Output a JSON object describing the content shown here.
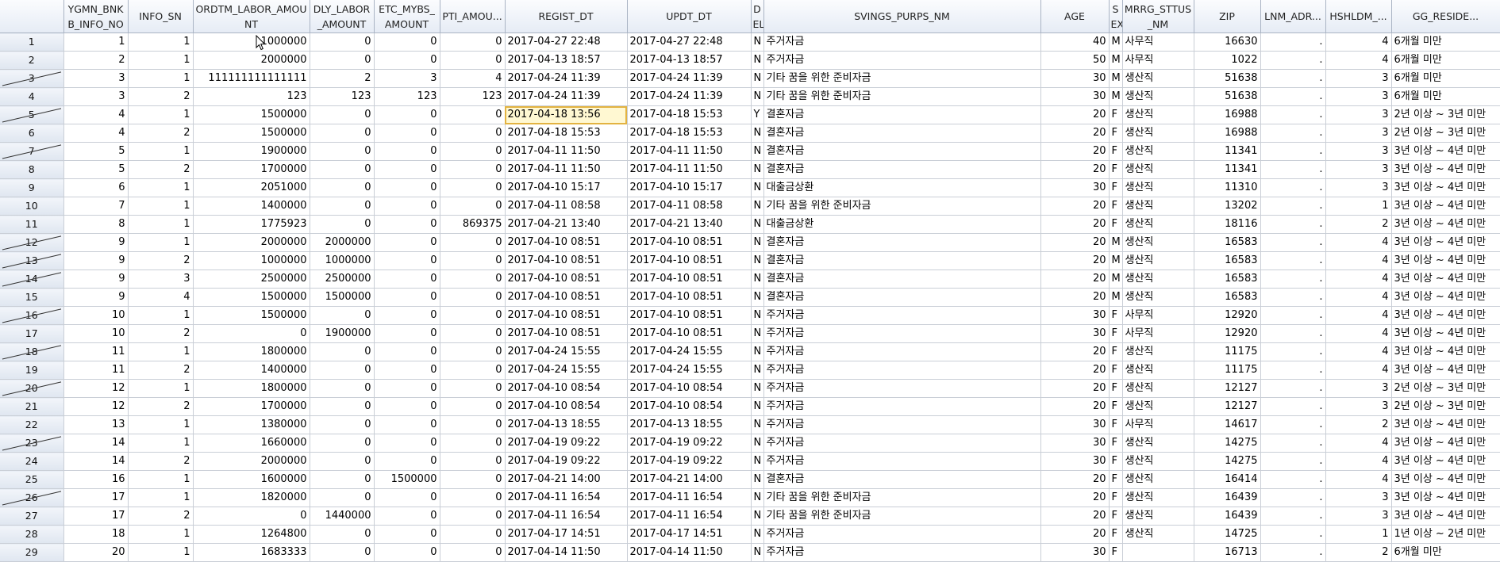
{
  "columns": [
    "",
    "YGMN_BNKB_INFO_NO",
    "INFO_SN",
    "ORDTM_LABOR_AMOUNT",
    "DLY_LABOR_AMOUNT",
    "ETC_MYBS_AMOUNT",
    "PTI_AMOU...",
    "REGIST_DT",
    "UPDT_DT",
    "DEL",
    "SVINGS_PURPS_NM",
    "AGE",
    "SEX",
    "MRRG_STTUS_NM",
    "ZIP",
    "LNM_ADR...",
    "HSHLDM_...",
    "GG_RESIDE..."
  ],
  "header_lines": [
    [
      ""
    ],
    [
      "YGMN_BNK",
      "B_INFO_NO"
    ],
    [
      "INFO_SN"
    ],
    [
      "ORDTM_LABOR_AMOU",
      "NT"
    ],
    [
      "DLY_LABOR",
      "_AMOUNT"
    ],
    [
      "ETC_MYBS_",
      "AMOUNT"
    ],
    [
      "PTI_AMOU..."
    ],
    [
      "REGIST_DT"
    ],
    [
      "UPDT_DT"
    ],
    [
      "D",
      "EL"
    ],
    [
      "SVINGS_PURPS_NM"
    ],
    [
      "AGE"
    ],
    [
      "S",
      "EX"
    ],
    [
      "MRRG_STTUS",
      "_NM"
    ],
    [
      "ZIP"
    ],
    [
      "LNM_ADR..."
    ],
    [
      "HSHLDM_..."
    ],
    [
      "GG_RESIDE..."
    ]
  ],
  "selected_cell": {
    "row": 5,
    "column": "REGIST_DT"
  },
  "accent_color": "#e3b341",
  "rows": [
    {
      "n": "1",
      "struck": false,
      "c": [
        "1",
        "1",
        "1000000",
        "0",
        "0",
        "0",
        "2017-04-27 22:48",
        "2017-04-27 22:48",
        "N",
        "주거자금",
        "40",
        "M",
        "사무직",
        "16630",
        ".",
        "4",
        "6개월 미만"
      ]
    },
    {
      "n": "2",
      "struck": false,
      "c": [
        "2",
        "1",
        "2000000",
        "0",
        "0",
        "0",
        "2017-04-13 18:57",
        "2017-04-13 18:57",
        "N",
        "주거자금",
        "50",
        "M",
        "사무직",
        "1022",
        ".",
        "4",
        "6개월 미만"
      ]
    },
    {
      "n": "3",
      "struck": true,
      "c": [
        "3",
        "1",
        "111111111111111",
        "2",
        "3",
        "4",
        "2017-04-24 11:39",
        "2017-04-24 11:39",
        "N",
        "기타 꿈을 위한 준비자금",
        "30",
        "M",
        "생산직",
        "51638",
        ".",
        "3",
        "6개월 미만"
      ]
    },
    {
      "n": "4",
      "struck": false,
      "c": [
        "3",
        "2",
        "123",
        "123",
        "123",
        "123",
        "2017-04-24 11:39",
        "2017-04-24 11:39",
        "N",
        "기타 꿈을 위한 준비자금",
        "30",
        "M",
        "생산직",
        "51638",
        ".",
        "3",
        "6개월 미만"
      ]
    },
    {
      "n": "5",
      "struck": true,
      "c": [
        "4",
        "1",
        "1500000",
        "0",
        "0",
        "0",
        "2017-04-18 13:56",
        "2017-04-18 15:53",
        "Y",
        "결혼자금",
        "20",
        "F",
        "생산직",
        "16988",
        ".",
        "3",
        "2년 이상 ~ 3년 미만"
      ]
    },
    {
      "n": "6",
      "struck": false,
      "c": [
        "4",
        "2",
        "1500000",
        "0",
        "0",
        "0",
        "2017-04-18 15:53",
        "2017-04-18 15:53",
        "N",
        "결혼자금",
        "20",
        "F",
        "생산직",
        "16988",
        ".",
        "3",
        "2년 이상 ~ 3년 미만"
      ]
    },
    {
      "n": "7",
      "struck": true,
      "c": [
        "5",
        "1",
        "1900000",
        "0",
        "0",
        "0",
        "2017-04-11 11:50",
        "2017-04-11 11:50",
        "N",
        "결혼자금",
        "20",
        "F",
        "생산직",
        "11341",
        ".",
        "3",
        "3년 이상 ~ 4년 미만"
      ]
    },
    {
      "n": "8",
      "struck": false,
      "c": [
        "5",
        "2",
        "1700000",
        "0",
        "0",
        "0",
        "2017-04-11 11:50",
        "2017-04-11 11:50",
        "N",
        "결혼자금",
        "20",
        "F",
        "생산직",
        "11341",
        ".",
        "3",
        "3년 이상 ~ 4년 미만"
      ]
    },
    {
      "n": "9",
      "struck": false,
      "c": [
        "6",
        "1",
        "2051000",
        "0",
        "0",
        "0",
        "2017-04-10 15:17",
        "2017-04-10 15:17",
        "N",
        "대출금상환",
        "30",
        "F",
        "생산직",
        "11310",
        ".",
        "3",
        "3년 이상 ~ 4년 미만"
      ]
    },
    {
      "n": "10",
      "struck": false,
      "c": [
        "7",
        "1",
        "1400000",
        "0",
        "0",
        "0",
        "2017-04-11 08:58",
        "2017-04-11 08:58",
        "N",
        "기타 꿈을 위한 준비자금",
        "20",
        "F",
        "생산직",
        "13202",
        ".",
        "1",
        "3년 이상 ~ 4년 미만"
      ]
    },
    {
      "n": "11",
      "struck": false,
      "c": [
        "8",
        "1",
        "1775923",
        "0",
        "0",
        "869375",
        "2017-04-21 13:40",
        "2017-04-21 13:40",
        "N",
        "대출금상환",
        "20",
        "F",
        "생산직",
        "18116",
        ".",
        "2",
        "3년 이상 ~ 4년 미만"
      ]
    },
    {
      "n": "12",
      "struck": true,
      "c": [
        "9",
        "1",
        "2000000",
        "2000000",
        "0",
        "0",
        "2017-04-10 08:51",
        "2017-04-10 08:51",
        "N",
        "결혼자금",
        "20",
        "M",
        "생산직",
        "16583",
        ".",
        "4",
        "3년 이상 ~ 4년 미만"
      ]
    },
    {
      "n": "13",
      "struck": true,
      "c": [
        "9",
        "2",
        "1000000",
        "1000000",
        "0",
        "0",
        "2017-04-10 08:51",
        "2017-04-10 08:51",
        "N",
        "결혼자금",
        "20",
        "M",
        "생산직",
        "16583",
        ".",
        "4",
        "3년 이상 ~ 4년 미만"
      ]
    },
    {
      "n": "14",
      "struck": true,
      "c": [
        "9",
        "3",
        "2500000",
        "2500000",
        "0",
        "0",
        "2017-04-10 08:51",
        "2017-04-10 08:51",
        "N",
        "결혼자금",
        "20",
        "M",
        "생산직",
        "16583",
        ".",
        "4",
        "3년 이상 ~ 4년 미만"
      ]
    },
    {
      "n": "15",
      "struck": false,
      "c": [
        "9",
        "4",
        "1500000",
        "1500000",
        "0",
        "0",
        "2017-04-10 08:51",
        "2017-04-10 08:51",
        "N",
        "결혼자금",
        "20",
        "M",
        "생산직",
        "16583",
        ".",
        "4",
        "3년 이상 ~ 4년 미만"
      ]
    },
    {
      "n": "16",
      "struck": true,
      "c": [
        "10",
        "1",
        "1500000",
        "0",
        "0",
        "0",
        "2017-04-10 08:51",
        "2017-04-10 08:51",
        "N",
        "주거자금",
        "30",
        "F",
        "사무직",
        "12920",
        ".",
        "4",
        "3년 이상 ~ 4년 미만"
      ]
    },
    {
      "n": "17",
      "struck": false,
      "c": [
        "10",
        "2",
        "0",
        "1900000",
        "0",
        "0",
        "2017-04-10 08:51",
        "2017-04-10 08:51",
        "N",
        "주거자금",
        "30",
        "F",
        "사무직",
        "12920",
        ".",
        "4",
        "3년 이상 ~ 4년 미만"
      ]
    },
    {
      "n": "18",
      "struck": true,
      "c": [
        "11",
        "1",
        "1800000",
        "0",
        "0",
        "0",
        "2017-04-24 15:55",
        "2017-04-24 15:55",
        "N",
        "주거자금",
        "20",
        "F",
        "생산직",
        "11175",
        ".",
        "4",
        "3년 이상 ~ 4년 미만"
      ]
    },
    {
      "n": "19",
      "struck": false,
      "c": [
        "11",
        "2",
        "1400000",
        "0",
        "0",
        "0",
        "2017-04-24 15:55",
        "2017-04-24 15:55",
        "N",
        "주거자금",
        "20",
        "F",
        "생산직",
        "11175",
        ".",
        "4",
        "3년 이상 ~ 4년 미만"
      ]
    },
    {
      "n": "20",
      "struck": true,
      "c": [
        "12",
        "1",
        "1800000",
        "0",
        "0",
        "0",
        "2017-04-10 08:54",
        "2017-04-10 08:54",
        "N",
        "주거자금",
        "20",
        "F",
        "생산직",
        "12127",
        ".",
        "3",
        "2년 이상 ~ 3년 미만"
      ]
    },
    {
      "n": "21",
      "struck": false,
      "c": [
        "12",
        "2",
        "1700000",
        "0",
        "0",
        "0",
        "2017-04-10 08:54",
        "2017-04-10 08:54",
        "N",
        "주거자금",
        "20",
        "F",
        "생산직",
        "12127",
        ".",
        "3",
        "2년 이상 ~ 3년 미만"
      ]
    },
    {
      "n": "22",
      "struck": false,
      "c": [
        "13",
        "1",
        "1380000",
        "0",
        "0",
        "0",
        "2017-04-13 18:55",
        "2017-04-13 18:55",
        "N",
        "주거자금",
        "30",
        "F",
        "사무직",
        "14617",
        ".",
        "2",
        "3년 이상 ~ 4년 미만"
      ]
    },
    {
      "n": "23",
      "struck": true,
      "c": [
        "14",
        "1",
        "1660000",
        "0",
        "0",
        "0",
        "2017-04-19 09:22",
        "2017-04-19 09:22",
        "N",
        "주거자금",
        "30",
        "F",
        "생산직",
        "14275",
        ".",
        "4",
        "3년 이상 ~ 4년 미만"
      ]
    },
    {
      "n": "24",
      "struck": false,
      "c": [
        "14",
        "2",
        "2000000",
        "0",
        "0",
        "0",
        "2017-04-19 09:22",
        "2017-04-19 09:22",
        "N",
        "주거자금",
        "30",
        "F",
        "생산직",
        "14275",
        ".",
        "4",
        "3년 이상 ~ 4년 미만"
      ]
    },
    {
      "n": "25",
      "struck": false,
      "c": [
        "16",
        "1",
        "1600000",
        "0",
        "1500000",
        "0",
        "2017-04-21 14:00",
        "2017-04-21 14:00",
        "N",
        "결혼자금",
        "20",
        "F",
        "생산직",
        "16414",
        ".",
        "4",
        "3년 이상 ~ 4년 미만"
      ]
    },
    {
      "n": "26",
      "struck": true,
      "c": [
        "17",
        "1",
        "1820000",
        "0",
        "0",
        "0",
        "2017-04-11 16:54",
        "2017-04-11 16:54",
        "N",
        "기타 꿈을 위한 준비자금",
        "20",
        "F",
        "생산직",
        "16439",
        ".",
        "3",
        "3년 이상 ~ 4년 미만"
      ]
    },
    {
      "n": "27",
      "struck": false,
      "c": [
        "17",
        "2",
        "0",
        "1440000",
        "0",
        "0",
        "2017-04-11 16:54",
        "2017-04-11 16:54",
        "N",
        "기타 꿈을 위한 준비자금",
        "20",
        "F",
        "생산직",
        "16439",
        ".",
        "3",
        "3년 이상 ~ 4년 미만"
      ]
    },
    {
      "n": "28",
      "struck": false,
      "c": [
        "18",
        "1",
        "1264800",
        "0",
        "0",
        "0",
        "2017-04-17 14:51",
        "2017-04-17 14:51",
        "N",
        "주거자금",
        "20",
        "F",
        "생산직",
        "14725",
        ".",
        "1",
        "1년 이상 ~ 2년 미만"
      ]
    },
    {
      "n": "29",
      "struck": false,
      "c": [
        "20",
        "1",
        "1683333",
        "0",
        "0",
        "0",
        "2017-04-14 11:50",
        "2017-04-14 11:50",
        "N",
        "주거자금",
        "30",
        "F",
        "",
        "16713",
        ".",
        "2",
        "6개월 미만"
      ]
    }
  ]
}
